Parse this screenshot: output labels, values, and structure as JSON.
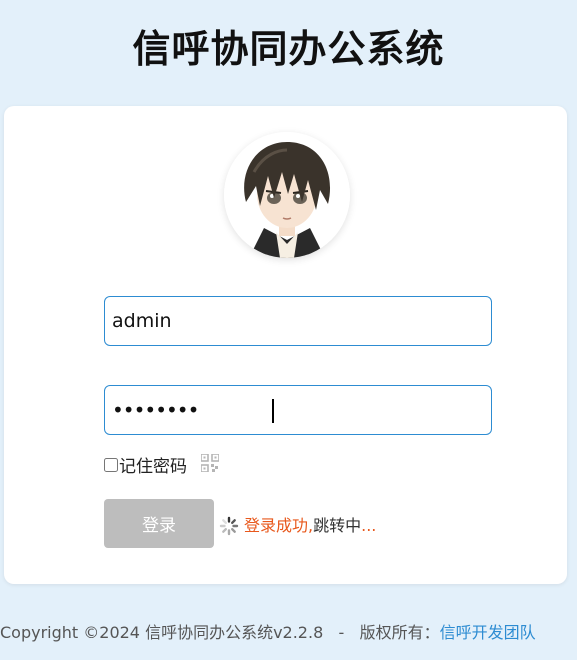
{
  "header": {
    "title": "信呼协同办公系统"
  },
  "login": {
    "username_value": "admin",
    "password_value": "••••••••",
    "remember_label": "记住密码",
    "login_label": "登录",
    "status_success": "登录成功,",
    "status_redirect": "跳转中",
    "status_dots": "..."
  },
  "footer": {
    "copyright": "Copyright ©2024 信呼协同办公系统v2.2.8",
    "separator": "-",
    "rights_label": "版权所有：",
    "team_link": "信呼开发团队"
  },
  "colors": {
    "page_bg": "#e3f0fa",
    "accent": "#2d8cd2",
    "status_orange": "#e8581c",
    "button_disabled": "#bdbdbd"
  },
  "icons": {
    "avatar": "anime-avatar",
    "qr": "qr-code-icon",
    "spinner": "loading-spinner-icon"
  }
}
